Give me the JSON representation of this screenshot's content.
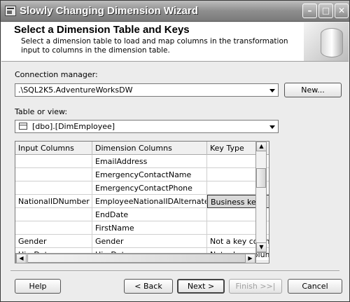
{
  "window": {
    "title": "Slowly Changing Dimension Wizard"
  },
  "title_buttons": {
    "minimize": "–",
    "maximize": "□",
    "close": "✕"
  },
  "header": {
    "title": "Select a Dimension Table and Keys",
    "description": "Select a dimension table to load and map columns in the transformation input to columns in the dimension table."
  },
  "connection": {
    "label": "Connection manager:",
    "value": ".\\SQL2K5.AdventureWorksDW",
    "new_button": "New..."
  },
  "table": {
    "label": "Table or view:",
    "value": "[dbo].[DimEmployee]",
    "icon": "table-icon"
  },
  "grid": {
    "columns": [
      "Input Columns",
      "Dimension Columns",
      "Key Type"
    ],
    "rows": [
      {
        "input": "",
        "dimension": "EmailAddress",
        "key": ""
      },
      {
        "input": "",
        "dimension": "EmergencyContactName",
        "key": ""
      },
      {
        "input": "",
        "dimension": "EmergencyContactPhone",
        "key": ""
      },
      {
        "input": "NationalIDNumber",
        "dimension": "EmployeeNationalIDAlternateKey",
        "key": "Business key"
      },
      {
        "input": "",
        "dimension": "EndDate",
        "key": ""
      },
      {
        "input": "",
        "dimension": "FirstName",
        "key": ""
      },
      {
        "input": "Gender",
        "dimension": "Gender",
        "key": "Not a key column"
      },
      {
        "input": "HireDate",
        "dimension": "HireDate",
        "key": "Not a key column"
      }
    ]
  },
  "buttons": {
    "help": "Help",
    "back": "< Back",
    "next": "Next >",
    "finish": "Finish >>|",
    "cancel": "Cancel"
  }
}
